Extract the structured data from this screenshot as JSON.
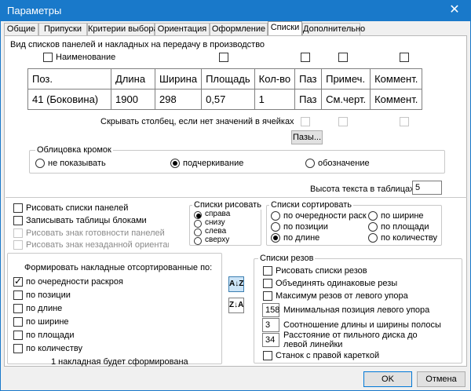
{
  "window": {
    "title": "Параметры",
    "close_glyph": "✕"
  },
  "tabs": [
    "Общие",
    "Припуски",
    "Критерии выбора",
    "Ориентация",
    "Оформление",
    "Списки",
    "Дополнительно"
  ],
  "active_tab": "Списки",
  "top_group": {
    "title": "Вид списков панелей и накладных на передачу в производство",
    "name_checkbox_label": "Наименование",
    "table": {
      "headers": [
        "Поз.",
        "Длина",
        "Ширина",
        "Площадь",
        "Кол-во",
        "Паз",
        "Примеч.",
        "Коммент."
      ],
      "row": [
        "41 (Боковина)",
        "1900",
        "298",
        "0,57",
        "1",
        "Паз",
        "См.черт.",
        "Коммент."
      ]
    },
    "hide_column_label": "Скрывать столбец, если нет значений в ячейках",
    "grooves_button": "Пазы..."
  },
  "edge_group": {
    "title": "Облицовка кромок",
    "options": [
      "не показывать",
      "подчеркивание",
      "обозначение"
    ],
    "selected": "подчеркивание"
  },
  "text_height": {
    "label": "Высота текста в таблицах",
    "value": "5"
  },
  "panel_options": [
    {
      "label": "Рисовать списки панелей",
      "checked": false,
      "enabled": true
    },
    {
      "label": "Записывать таблицы блоками",
      "checked": false,
      "enabled": true
    },
    {
      "label": "Рисовать знак готовности панелей",
      "checked": false,
      "enabled": false
    },
    {
      "label": "Рисовать знак незаданной ориентации",
      "checked": false,
      "enabled": false
    }
  ],
  "draw_lists": {
    "title": "Списки рисовать",
    "options": [
      "справа",
      "снизу",
      "слева",
      "сверху"
    ],
    "selected": "справа"
  },
  "sort_lists": {
    "title": "Списки сортировать",
    "options_left": [
      "по очередности раскроя",
      "по позиции",
      "по длине"
    ],
    "options_right": [
      "по ширине",
      "по площади",
      "по количеству"
    ],
    "selected": "по длине"
  },
  "invoices": {
    "title": "Формировать накладные отсортированные по:",
    "options": [
      {
        "label": "по очередности раскроя",
        "checked": true
      },
      {
        "label": "по позиции",
        "checked": false
      },
      {
        "label": "по длине",
        "checked": false
      },
      {
        "label": "по ширине",
        "checked": false
      },
      {
        "label": "по площади",
        "checked": false
      },
      {
        "label": "по количеству",
        "checked": false
      }
    ],
    "footer": "1 накладная будет сформирована",
    "sort_asc_label": "A↓Z",
    "sort_desc_label": "Z↓A"
  },
  "cut_lists": {
    "title": "Списки резов",
    "checkboxes": [
      "Рисовать списки резов",
      "Объединять одинаковые резы",
      "Максимум резов от левого упора"
    ],
    "fields": [
      {
        "value": "158",
        "label": "Минимальная позиция левого упора"
      },
      {
        "value": "3",
        "label": "Соотношение длины и ширины полосы"
      },
      {
        "value": "34",
        "label": "Расстояние от пильного диска до левой линейки"
      }
    ],
    "carriage_label": "Станок с правой кареткой"
  },
  "buttons": {
    "ok": "OK",
    "cancel": "Отмена"
  }
}
